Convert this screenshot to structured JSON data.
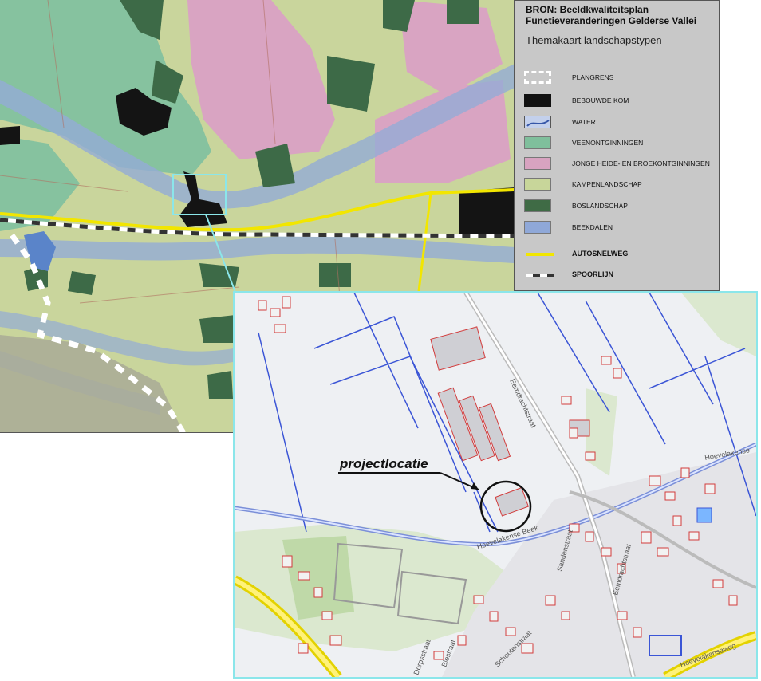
{
  "legend": {
    "source_line1": "BRON: Beeldkwaliteitsplan",
    "source_line2": "Functieveranderingen Gelderse Vallei",
    "subtitle": "Themakaart landschapstypen",
    "items": [
      {
        "label": "PLANGRENS",
        "color": "#ffffff"
      },
      {
        "label": "BEBOUWDE KOM",
        "color": "#111111"
      },
      {
        "label": "WATER",
        "color": "#8aa5d8"
      },
      {
        "label": "VEENONTGINNINGEN",
        "color": "#7fbf9c"
      },
      {
        "label": "JONGE HEIDE- EN BROEKONTGINNINGEN",
        "color": "#d8a3c0"
      },
      {
        "label": "KAMPENLANDSCHAP",
        "color": "#c8d69a"
      },
      {
        "label": "BOSLANDSCHAP",
        "color": "#3f6b45"
      },
      {
        "label": "BEEKDALEN",
        "color": "#8fa8d8"
      }
    ],
    "lines": [
      {
        "label": "AUTOSNELWEG",
        "color": "#f2e600"
      },
      {
        "label": "SPOORLIJN",
        "color": "#333333"
      }
    ]
  },
  "detail": {
    "project_label": "projectlocatie",
    "streets": [
      "Eemdrachtstraat",
      "Hoevelakense Beek",
      "Hoevelakenseweg",
      "Hoevelakense",
      "Sandenstraat",
      "Eemdrachtstraat",
      "Dorpsstraat",
      "Biestraat",
      "Schoutenstraat"
    ]
  }
}
